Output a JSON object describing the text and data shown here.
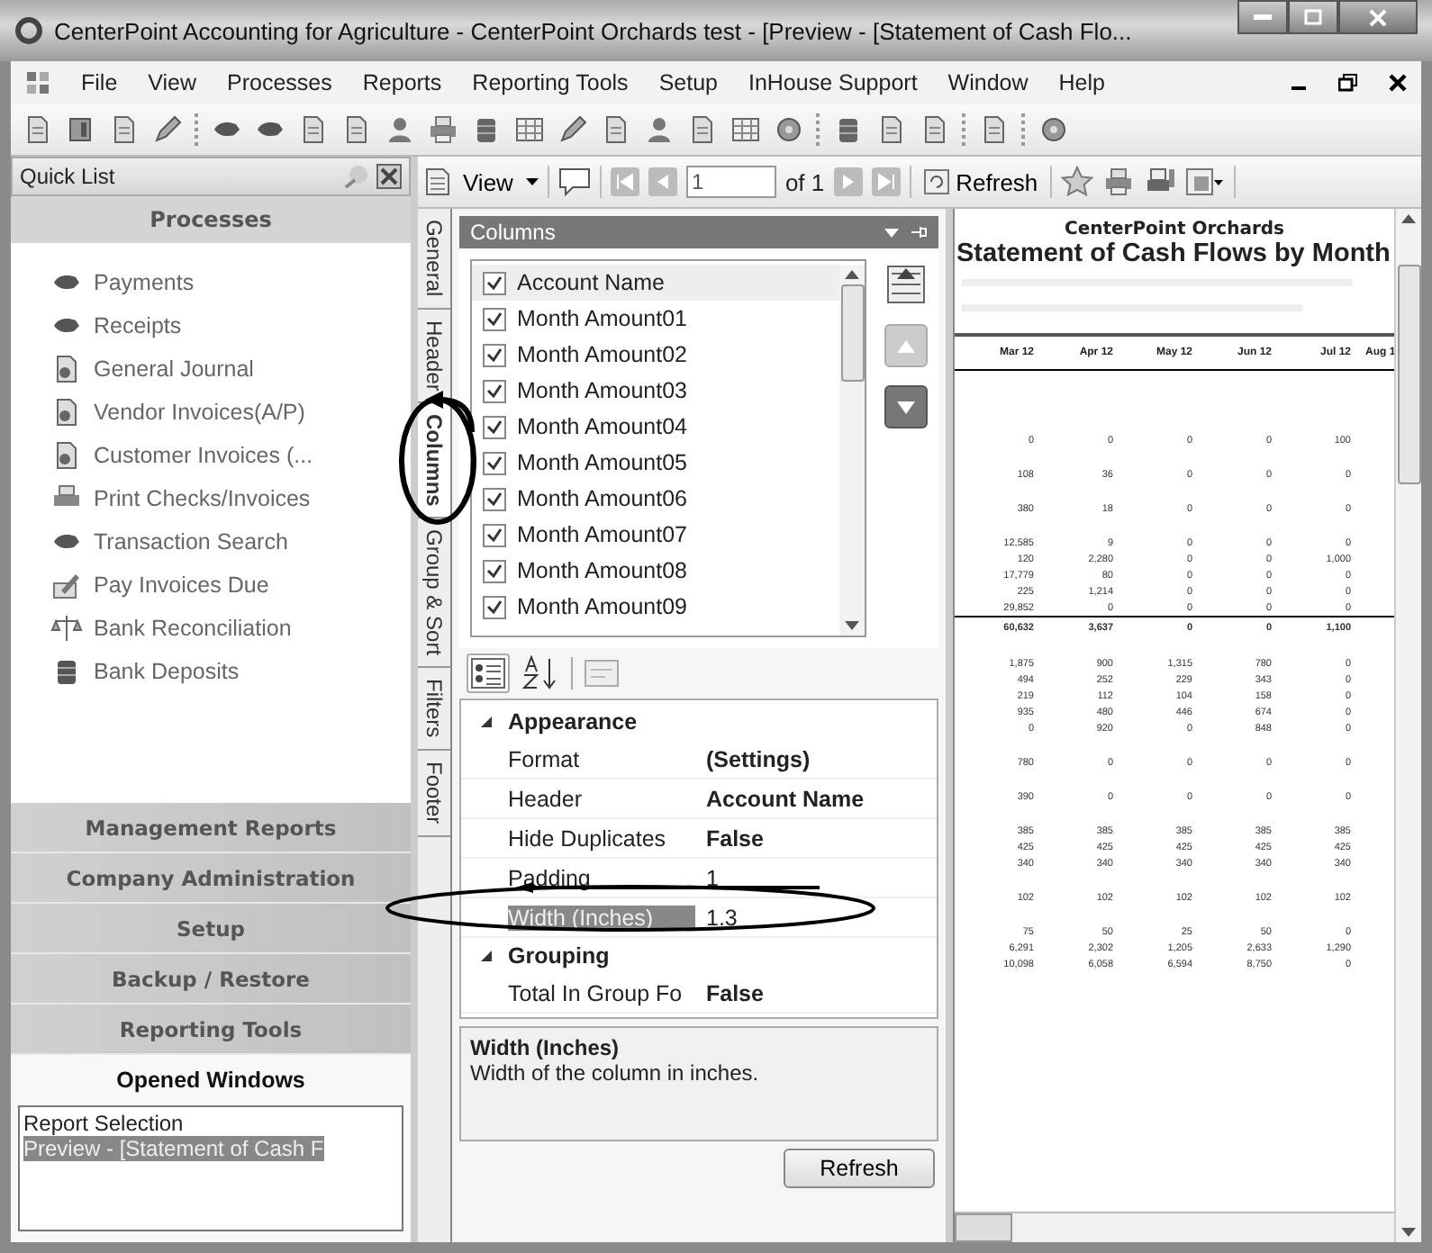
{
  "window": {
    "title": "CenterPoint Accounting for Agriculture - CenterPoint Orchards test - [Preview - [Statement of Cash Flo..."
  },
  "menu": [
    "File",
    "View",
    "Processes",
    "Reports",
    "Reporting Tools",
    "Setup",
    "InHouse Support",
    "Window",
    "Help"
  ],
  "quick_list": {
    "title": "Quick List",
    "processes": {
      "title": "Processes",
      "items": [
        "Payments",
        "Receipts",
        "General Journal",
        "Vendor Invoices(A/P)",
        "Customer Invoices (...",
        "Print Checks/Invoices",
        "Transaction Search",
        "Pay Invoices Due",
        "Bank Reconciliation",
        "Bank Deposits"
      ]
    },
    "sections": [
      "Management Reports",
      "Company Administration",
      "Setup",
      "Backup / Restore",
      "Reporting Tools"
    ],
    "opened_windows": {
      "title": "Opened Windows",
      "items": [
        {
          "label": "Report Selection",
          "selected": false
        },
        {
          "label": "Preview - [Statement of Cash F",
          "selected": true
        }
      ]
    }
  },
  "report_toolbar": {
    "view": "View",
    "page": "1",
    "of": "of 1",
    "refresh": "Refresh"
  },
  "side_tabs": [
    {
      "label": "General",
      "selected": false
    },
    {
      "label": "Header",
      "selected": false
    },
    {
      "label": "Columns",
      "selected": true
    },
    {
      "label": "Group & Sort",
      "selected": false
    },
    {
      "label": "Filters",
      "selected": false
    },
    {
      "label": "Footer",
      "selected": false
    }
  ],
  "columns_panel": {
    "title": "Columns",
    "items": [
      {
        "label": "Account Name",
        "checked": true,
        "selected": true
      },
      {
        "label": "Month Amount01",
        "checked": true,
        "selected": false
      },
      {
        "label": "Month Amount02",
        "checked": true,
        "selected": false
      },
      {
        "label": "Month Amount03",
        "checked": true,
        "selected": false
      },
      {
        "label": "Month Amount04",
        "checked": true,
        "selected": false
      },
      {
        "label": "Month Amount05",
        "checked": true,
        "selected": false
      },
      {
        "label": "Month Amount06",
        "checked": true,
        "selected": false
      },
      {
        "label": "Month Amount07",
        "checked": true,
        "selected": false
      },
      {
        "label": "Month Amount08",
        "checked": true,
        "selected": false
      },
      {
        "label": "Month Amount09",
        "checked": true,
        "selected": false
      }
    ],
    "properties": [
      {
        "kind": "category",
        "label": "Appearance"
      },
      {
        "kind": "property",
        "name": "Format",
        "value": "(Settings)",
        "bold": true,
        "selected": false
      },
      {
        "kind": "property",
        "name": "Header",
        "value": "Account Name",
        "bold": true,
        "selected": false
      },
      {
        "kind": "property",
        "name": "Hide Duplicates",
        "value": "False",
        "bold": true,
        "selected": false
      },
      {
        "kind": "property",
        "name": "Padding",
        "value": "1",
        "bold": false,
        "selected": false
      },
      {
        "kind": "property",
        "name": "Width (Inches)",
        "value": "1.3",
        "bold": false,
        "selected": true
      },
      {
        "kind": "category",
        "label": "Grouping"
      },
      {
        "kind": "property",
        "name": "Total In Group Fo",
        "value": "False",
        "bold": true,
        "selected": false
      }
    ],
    "description": {
      "title": "Width (Inches)",
      "text": "Width of the column in inches."
    },
    "refresh": "Refresh"
  },
  "report": {
    "company": "CenterPoint Orchards",
    "title": "Statement of Cash Flows by Month",
    "columns": [
      "Mar 12",
      "Apr 12",
      "May 12",
      "Jun 12",
      "Jul 12",
      "Aug 1"
    ],
    "groups": [
      {
        "rows": [
          {
            "kind": "normal",
            "cells": [
              "0",
              "0",
              "0",
              "0",
              "100"
            ]
          }
        ]
      },
      {
        "rows": [
          {
            "kind": "normal",
            "cells": [
              "108",
              "36",
              "0",
              "0",
              "0"
            ]
          }
        ]
      },
      {
        "rows": [
          {
            "kind": "normal",
            "cells": [
              "380",
              "18",
              "0",
              "0",
              "0"
            ]
          }
        ]
      },
      {
        "rows": [
          {
            "kind": "normal",
            "cells": [
              "12,585",
              "9",
              "0",
              "0",
              "0"
            ]
          },
          {
            "kind": "normal",
            "cells": [
              "120",
              "2,280",
              "0",
              "0",
              "1,000"
            ]
          },
          {
            "kind": "normal",
            "cells": [
              "17,779",
              "80",
              "0",
              "0",
              "0"
            ]
          },
          {
            "kind": "normal",
            "cells": [
              "225",
              "1,214",
              "0",
              "0",
              "0"
            ]
          },
          {
            "kind": "normal",
            "cells": [
              "29,852",
              "0",
              "0",
              "0",
              "0"
            ]
          },
          {
            "kind": "total",
            "cells": [
              "60,632",
              "3,637",
              "0",
              "0",
              "1,100"
            ]
          }
        ]
      },
      {
        "rows": [
          {
            "kind": "normal",
            "cells": [
              "1,875",
              "900",
              "1,315",
              "780",
              "0"
            ]
          },
          {
            "kind": "normal",
            "cells": [
              "494",
              "252",
              "229",
              "343",
              "0"
            ]
          },
          {
            "kind": "normal",
            "cells": [
              "219",
              "112",
              "104",
              "158",
              "0"
            ]
          },
          {
            "kind": "normal",
            "cells": [
              "935",
              "480",
              "446",
              "674",
              "0"
            ]
          },
          {
            "kind": "normal",
            "cells": [
              "0",
              "920",
              "0",
              "848",
              "0"
            ]
          }
        ]
      },
      {
        "rows": [
          {
            "kind": "normal",
            "cells": [
              "780",
              "0",
              "0",
              "0",
              "0"
            ]
          }
        ]
      },
      {
        "rows": [
          {
            "kind": "normal",
            "cells": [
              "390",
              "0",
              "0",
              "0",
              "0"
            ]
          }
        ]
      },
      {
        "rows": [
          {
            "kind": "normal",
            "cells": [
              "385",
              "385",
              "385",
              "385",
              "385"
            ]
          },
          {
            "kind": "normal",
            "cells": [
              "425",
              "425",
              "425",
              "425",
              "425"
            ]
          },
          {
            "kind": "normal",
            "cells": [
              "340",
              "340",
              "340",
              "340",
              "340"
            ]
          }
        ]
      },
      {
        "rows": [
          {
            "kind": "normal",
            "cells": [
              "102",
              "102",
              "102",
              "102",
              "102"
            ]
          }
        ]
      },
      {
        "rows": [
          {
            "kind": "normal",
            "cells": [
              "75",
              "50",
              "25",
              "50",
              "0"
            ]
          },
          {
            "kind": "normal",
            "cells": [
              "6,291",
              "2,302",
              "1,205",
              "2,633",
              "1,290"
            ]
          },
          {
            "kind": "normal",
            "cells": [
              "10,098",
              "6,058",
              "6,594",
              "8,750",
              "0"
            ]
          }
        ]
      }
    ]
  }
}
